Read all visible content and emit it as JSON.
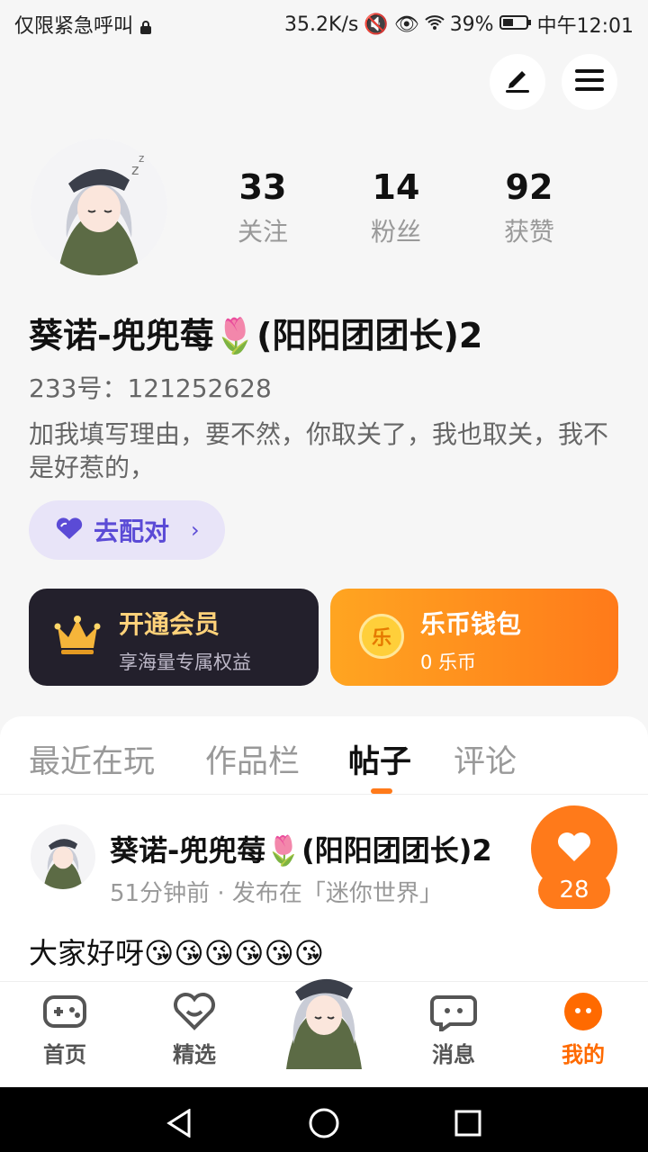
{
  "status_bar": {
    "carrier": "仅限紧急呼叫",
    "speed": "35.2K/s",
    "battery": "39%",
    "time": "中午12:01"
  },
  "header": {
    "edit_icon": "pen-icon",
    "menu_icon": "hamburger-icon"
  },
  "profile": {
    "stats": [
      {
        "value": "33",
        "label": "关注"
      },
      {
        "value": "14",
        "label": "粉丝"
      },
      {
        "value": "92",
        "label": "获赞"
      }
    ],
    "nickname": "葵诺-兜兜莓🌷(阳阳团团长)2",
    "uid": "233号：121252628",
    "bio": "加我填写理由，要不然，你取关了，我也取关，我不是好惹的，",
    "match_button": "去配对"
  },
  "cards": {
    "vip_title": "开通会员",
    "vip_sub": "享海量专属权益",
    "wallet_title": "乐币钱包",
    "wallet_sub": "0 乐币",
    "coin_char": "乐"
  },
  "tabs": [
    {
      "label": "最近在玩"
    },
    {
      "label": "作品栏"
    },
    {
      "label": "帖子"
    },
    {
      "label": "评论"
    }
  ],
  "post": {
    "author": "葵诺-兜兜莓🌷(阳阳团团长)2",
    "meta": "51分钟前 · 发布在「迷你世界」",
    "text": "大家好呀😘😘😘😘😘😘",
    "likes": "28"
  },
  "bottom_nav": [
    {
      "label": "首页"
    },
    {
      "label": "精选"
    },
    {
      "label": "消息"
    },
    {
      "label": "我的"
    }
  ],
  "colors": {
    "accent": "#ff7a1a",
    "match": "#5b4bd6",
    "vip_bg": "#23202c",
    "vip_text": "#ffd27a"
  }
}
